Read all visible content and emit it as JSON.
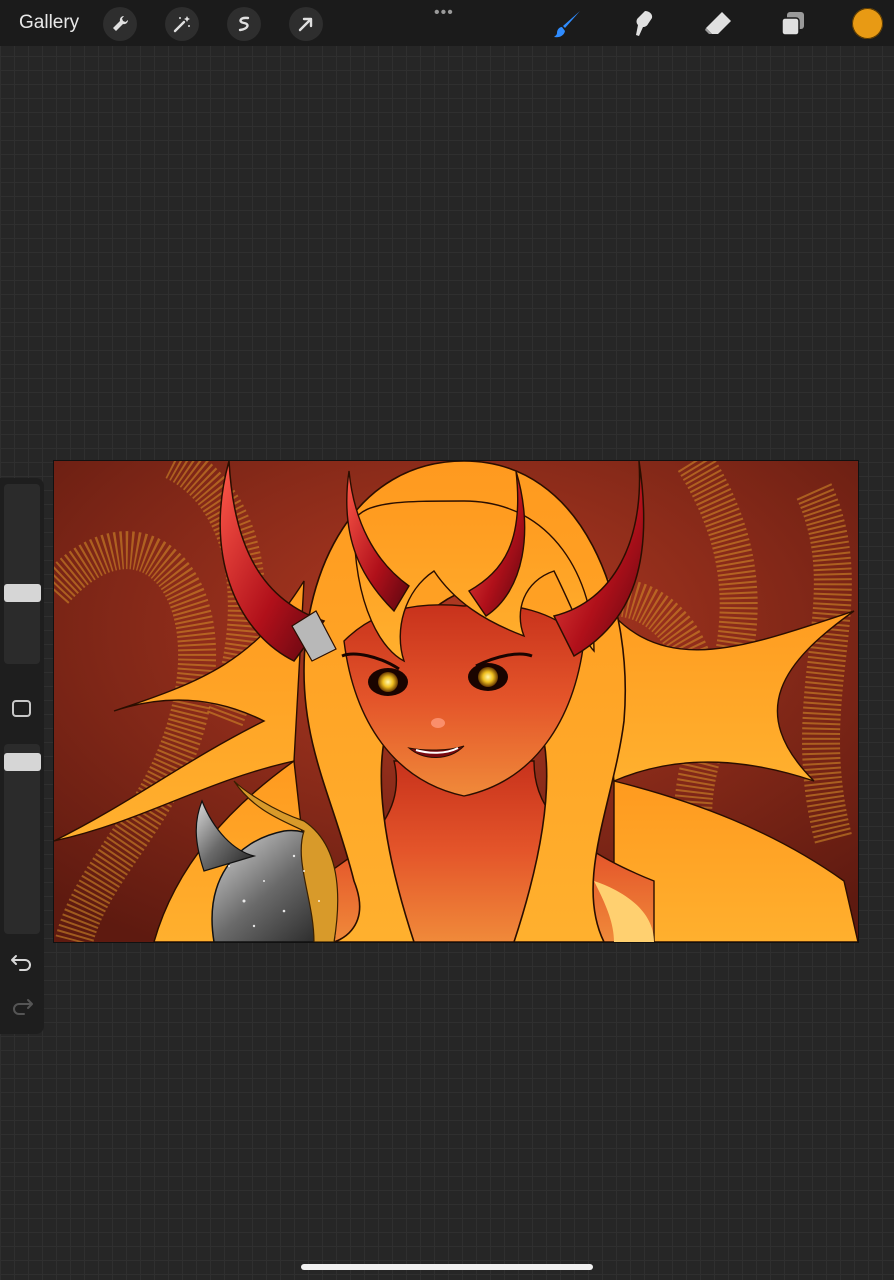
{
  "toolbar": {
    "gallery_label": "Gallery",
    "left_tools": [
      "wrench-icon",
      "magic-wand-icon",
      "selection-icon",
      "transform-arrow-icon"
    ],
    "more_label": "•••",
    "right_tools": [
      "brush-icon",
      "smudge-icon",
      "eraser-icon",
      "layers-icon"
    ],
    "active_tool": "brush",
    "current_color": "#e89a14"
  },
  "sidebar": {
    "brush_size_level": 0.4,
    "opacity_level": 0.05,
    "buttons": [
      "modify-button",
      "undo-button",
      "redo-button"
    ]
  },
  "canvas": {
    "artwork": "demon-girl-illustration",
    "palette": {
      "background": "#8e2416",
      "hair": "#f7a21a",
      "horn": "#b8121a",
      "skin": "#e45a26",
      "glitter": "#d89a2a"
    }
  }
}
